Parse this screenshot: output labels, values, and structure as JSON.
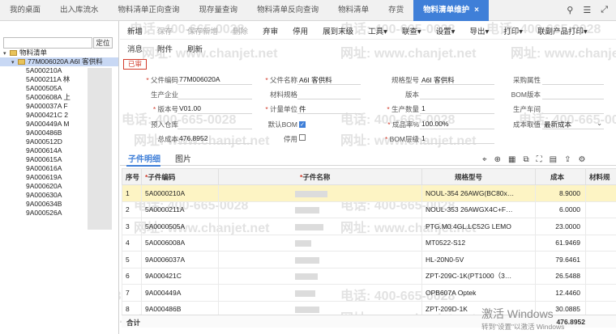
{
  "tabs": [
    {
      "label": "我的桌面"
    },
    {
      "label": "出入库流水"
    },
    {
      "label": "物料清单正向查询"
    },
    {
      "label": "现存量查询"
    },
    {
      "label": "物料清单反向查询"
    },
    {
      "label": "物料清单"
    },
    {
      "label": "存货"
    },
    {
      "label": "物料清单维护"
    }
  ],
  "tab_close": "×",
  "top_icons": [
    "search-icon",
    "menu-icon",
    "expand-icon"
  ],
  "left": {
    "search_placeholder": "",
    "locate_button": "定位",
    "tree": [
      {
        "label": "物料清单",
        "level": 0
      },
      {
        "label": "77M006020A A6I 客供料",
        "level": 1,
        "selected": true
      },
      {
        "label": "5A000210A",
        "level": 2
      },
      {
        "label": "5A000211A 林",
        "level": 2
      },
      {
        "label": "5A000505A",
        "level": 2
      },
      {
        "label": "5A000608A 上",
        "level": 2
      },
      {
        "label": "9A000037A F",
        "level": 2
      },
      {
        "label": "9A000421C 2",
        "level": 2
      },
      {
        "label": "9A000449A M",
        "level": 2
      },
      {
        "label": "9A000486B",
        "level": 2
      },
      {
        "label": "9A000512D",
        "level": 2
      },
      {
        "label": "9A000614A",
        "level": 2
      },
      {
        "label": "9A000615A",
        "level": 2
      },
      {
        "label": "9A000616A",
        "level": 2
      },
      {
        "label": "9A000619A",
        "level": 2
      },
      {
        "label": "9A000620A",
        "level": 2
      },
      {
        "label": "9A000630A",
        "level": 2
      },
      {
        "label": "9A000634B",
        "level": 2
      },
      {
        "label": "9A000526A",
        "level": 2
      }
    ]
  },
  "toolbar": {
    "row1": [
      {
        "label": "新增",
        "enabled": true
      },
      {
        "label": "保存",
        "enabled": false
      },
      {
        "label": "保存新增",
        "enabled": false
      },
      {
        "label": "删除",
        "enabled": false
      },
      {
        "label": "弃审",
        "enabled": true
      },
      {
        "label": "停用",
        "enabled": true
      },
      {
        "label": "展到末级",
        "enabled": true
      },
      {
        "label": "工具▾",
        "enabled": true
      },
      {
        "label": "联查▾",
        "enabled": true
      },
      {
        "label": "设置▾",
        "enabled": true
      },
      {
        "label": "导出▾",
        "enabled": true
      },
      {
        "label": "打印▾",
        "enabled": true
      },
      {
        "label": "联副产品打印▾",
        "enabled": true
      }
    ],
    "row2": [
      {
        "label": "消息"
      },
      {
        "label": "附件"
      },
      {
        "label": "刷新"
      }
    ]
  },
  "status_badge": "已审",
  "form": {
    "parent_code_label": "父件编码",
    "parent_code": "77M006020A",
    "parent_name_label": "父件名称",
    "parent_name": "A6I 客供料",
    "spec_label": "规格型号",
    "spec": "A6I 客供料",
    "purchase_attr_label": "采购属性",
    "manufacturer_label": "生产企业",
    "material_spec_label": "材料规格",
    "version_label": "版本",
    "bom_version_label": "BOM版本",
    "version_no_label": "版本号",
    "version_no": "V01.00",
    "unit_label": "计量单位",
    "unit": "件",
    "qty_label": "生产数量",
    "qty": "1",
    "workshop_label": "生产车间",
    "warehouse_label": "预入仓库",
    "default_bom_label": "默认BOM",
    "default_bom_check": "✓",
    "yield_label": "成品率%",
    "yield": "100.00%",
    "cost_pick_label": "成本取值",
    "cost_pick": "最新成本",
    "total_cost_label": "总成本",
    "total_cost": "476.8952",
    "disabled_label": "停用",
    "bom_level_label": "BOM层级",
    "bom_level": "1"
  },
  "subtabs": [
    {
      "label": "子件明细"
    },
    {
      "label": "图片"
    }
  ],
  "table_icons": [
    "location-icon",
    "add-row-icon",
    "grid-icon",
    "copy-icon",
    "fullscreen-icon",
    "paste-icon",
    "export-icon",
    "config-icon"
  ],
  "table": {
    "headers": {
      "seq": "序号",
      "code": "子件编码",
      "name": "子件名称",
      "spec": "规格型号",
      "cost": "成本",
      "mat": "材料规"
    },
    "rows": [
      {
        "seq": "1",
        "code": "5A0000210A",
        "spec": "NOUL-354 26AWG(BC80x…",
        "cost": "8.9000",
        "hl": true
      },
      {
        "seq": "2",
        "code": "5A0000211A",
        "spec": "NOUL-353 26AWGX4C+F…",
        "cost": "6.0000"
      },
      {
        "seq": "3",
        "code": "5A0000505A",
        "spec": "PTG.M0.4GL.LC52G  LEMO",
        "cost": "23.0000"
      },
      {
        "seq": "4",
        "code": "5A0006008A",
        "spec": "MT0522-S12",
        "cost": "61.9469"
      },
      {
        "seq": "5",
        "code": "9A0006037A",
        "spec": "HL-20N0-5V",
        "cost": "79.6461"
      },
      {
        "seq": "6",
        "code": "9A000421C",
        "spec": "ZPT-209C-1K(PT1000（3…",
        "cost": "26.5488"
      },
      {
        "seq": "7",
        "code": "9A000449A",
        "spec": "OPB607A Optek",
        "cost": "12.4460"
      },
      {
        "seq": "8",
        "code": "9A000486B",
        "spec": "ZPT-209D-1K",
        "cost": "30.0885"
      }
    ],
    "total_label": "合计",
    "total_cost": "476.8952"
  },
  "watermarks": {
    "phone": "电话: 400-665-0028",
    "site": "网址: www.chanjet.net"
  },
  "windows_activation": {
    "line1": "激活 Windows",
    "line2": "转到\"设置\"以激活 Windows"
  }
}
